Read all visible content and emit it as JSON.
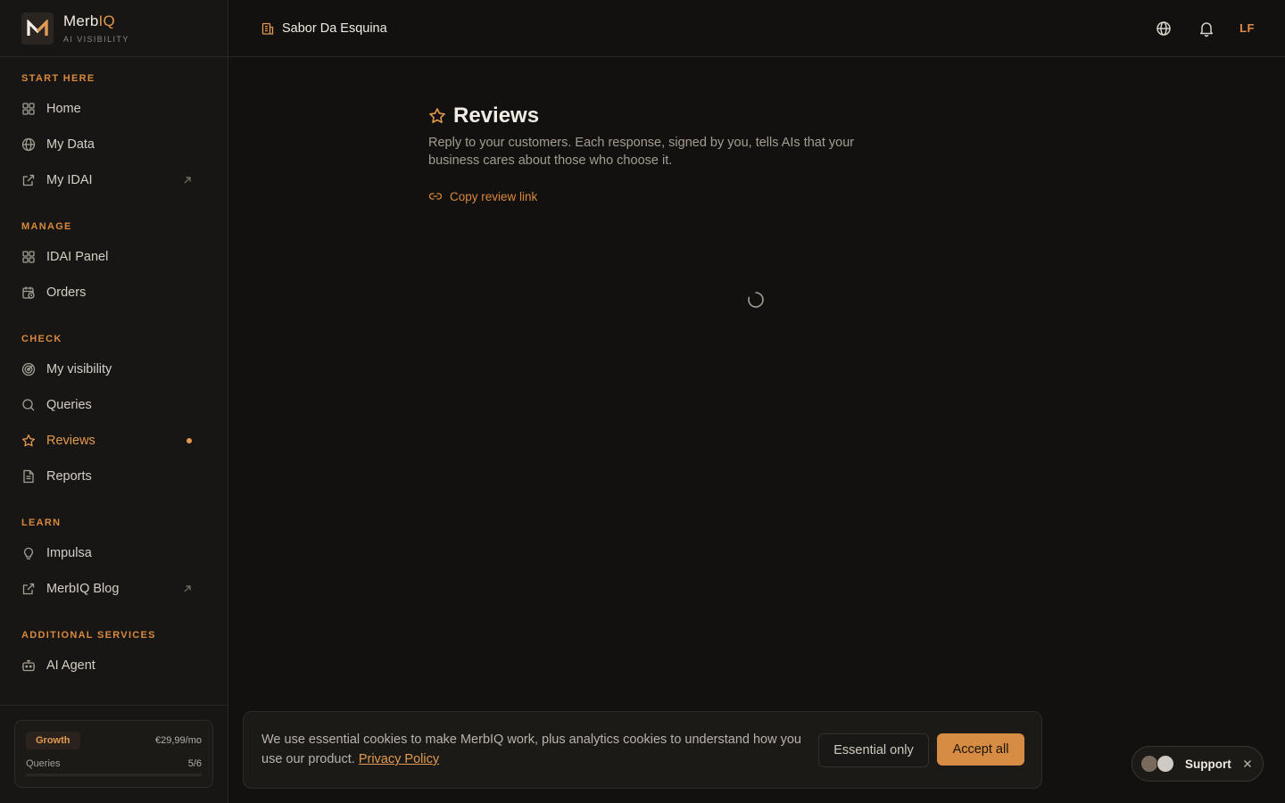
{
  "brand": {
    "name_prefix": "Merb",
    "name_accent": "IQ",
    "subtitle": "AI VISIBILITY"
  },
  "sections": {
    "start_here": "START HERE",
    "manage": "MANAGE",
    "check": "CHECK",
    "learn": "LEARN",
    "additional": "ADDITIONAL SERVICES"
  },
  "nav": {
    "home": "Home",
    "my_data": "My Data",
    "my_idai": "My IDAI",
    "idai_panel": "IDAI Panel",
    "orders": "Orders",
    "my_visibility": "My visibility",
    "queries": "Queries",
    "reviews": "Reviews",
    "reports": "Reports",
    "impulsa": "Impulsa",
    "blog": "MerbIQ Blog",
    "ai_agent": "AI Agent"
  },
  "plan": {
    "name": "Growth",
    "price": "€29,99/mo",
    "queries_label": "Queries",
    "queries_value": "5/6",
    "queries_used_fraction": 0.833
  },
  "topbar": {
    "business_name": "Sabor Da Esquina",
    "user_initials": "LF"
  },
  "page": {
    "title": "Reviews",
    "description": "Reply to your customers. Each response, signed by you, tells AIs that your business cares about those who choose it.",
    "copy_link": "Copy review link"
  },
  "cookie": {
    "text": "We use essential cookies to make MerbIQ work, plus analytics cookies to understand how you use our product.",
    "privacy_link": "Privacy Policy",
    "essential_btn": "Essential only",
    "accept_btn": "Accept all"
  },
  "support": {
    "label": "Support"
  },
  "colors": {
    "accent": "#e39a50",
    "background": "#13110f",
    "sidebar": "#181614"
  }
}
